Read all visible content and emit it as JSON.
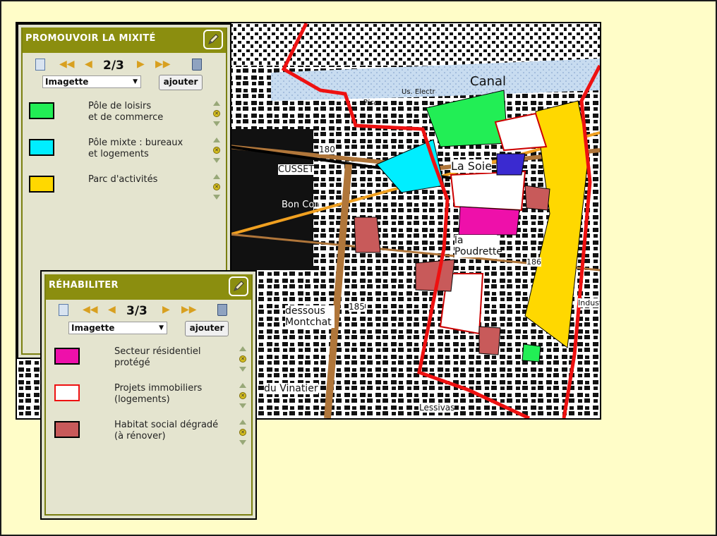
{
  "colors": {
    "page_bg": "#fffdc8",
    "panel_header": "#8b8e0f",
    "panel_body": "#e4e4cf",
    "loisirs": "#22ee55",
    "mixte": "#00eeff",
    "activites": "#ffd800",
    "residentiel": "#ee10aa",
    "projets": "#ffffff",
    "social": "#c85a5a",
    "perimeter": "#ee1111"
  },
  "map": {
    "labels": [
      "Canal",
      "La Soie",
      "CUSSET",
      "Bon Coin",
      "la Poudrette",
      "dessous Montchat",
      "du Vinatier",
      "Indust",
      "Lessivas",
      "180",
      "185",
      "186",
      "Pisc.",
      "Us. Electr"
    ]
  },
  "panel_top": {
    "title": "PROMOUVOIR LA MIXITÉ",
    "edit_icon": "pencil-icon",
    "page_indicator": "2/3",
    "select_value": "Imagette",
    "add_label": "ajouter",
    "items": [
      {
        "label": "Pôle de loisirs\net de commerce",
        "color": "#22ee55"
      },
      {
        "label": "Pôle mixte : bureaux\net logements",
        "color": "#00eeff"
      },
      {
        "label": "Parc d'activités",
        "color": "#ffd800"
      }
    ]
  },
  "panel_bottom": {
    "title": "RÉHABILITER",
    "edit_icon": "pencil-icon",
    "page_indicator": "3/3",
    "select_value": "Imagette",
    "add_label": "ajouter",
    "items": [
      {
        "label": "Secteur résidentiel\nprotégé",
        "color": "#ee10aa"
      },
      {
        "label": "Projets immobiliers\n(logements)",
        "color": "#ffffff"
      },
      {
        "label": "Habitat social dégradé\n(à rénover)",
        "color": "#c85a5a"
      }
    ]
  }
}
